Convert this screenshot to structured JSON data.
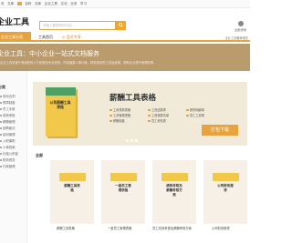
{
  "topnav": {
    "items": [
      "页",
      "文库",
      "",
      "百科",
      "文库",
      "",
      "",
      "",
      "企业工具",
      "",
      "",
      "文化",
      "",
      "",
      "",
      "业务",
      "",
      "",
      "",
      "",
      "",
      "",
      "学习"
    ]
  },
  "header": {
    "logo": "企业工具",
    "search_placeholder": "请输入要搜索的内容...",
    "hot": "热门搜索：",
    "user_label": "登录",
    "user_sub": "注册/登录"
  },
  "tabs": {
    "active": "企业工具分类",
    "home": "工具首页",
    "vip": "会员专享",
    "right_text": "企业工具备案相关"
  },
  "hero": {
    "title": "企业工具：中小企业一站式文档服务",
    "subtitle": "企业工具来源于有经验的人力资源及专业机构，内容涵盖人事行政，财务税务的工具及资源，帮助企业提升管理效率。"
  },
  "sidebar": {
    "heading": "分类",
    "items": [
      "劳动合同",
      "规章制度",
      "员工手册",
      "绩效考核",
      "薪酬管理",
      "招聘面试",
      "培训管理",
      "入职离职",
      "人事档案",
      "社保公积金",
      "财务税务",
      "行政管理"
    ]
  },
  "banner": {
    "title": "薪酬工具表格",
    "book_brand": "企业工具",
    "book_title": "公司薪酬工具表格",
    "features": [
      "工资核算表格",
      "工资结算表",
      "薪资明细单",
      "工资管理表格",
      "工资核算清单",
      "员工工资表",
      "薪酬制度",
      "员工考勤表"
    ],
    "cta": "打包下载"
  },
  "grid": {
    "heading": "全部",
    "cards": [
      {
        "title": "薪酬工具表格",
        "label": "薪酬工具表格"
      },
      {
        "title": "一套员工管理表格",
        "label": "一套员工管理表格"
      },
      {
        "title": "绩效考核及薪酬考核方案",
        "label": "员工绩效考核及薪酬考核方案"
      },
      {
        "title": "公司财务报表",
        "label": "公司财务报表"
      }
    ]
  },
  "colors": {
    "accent": "#e8a33d",
    "hero_bg": "#b99b6d",
    "banner_bg": "#f1ead9",
    "book_yellow": "#f2c84b",
    "book_green": "#4ea064",
    "book_blue": "#3f8fd1"
  }
}
